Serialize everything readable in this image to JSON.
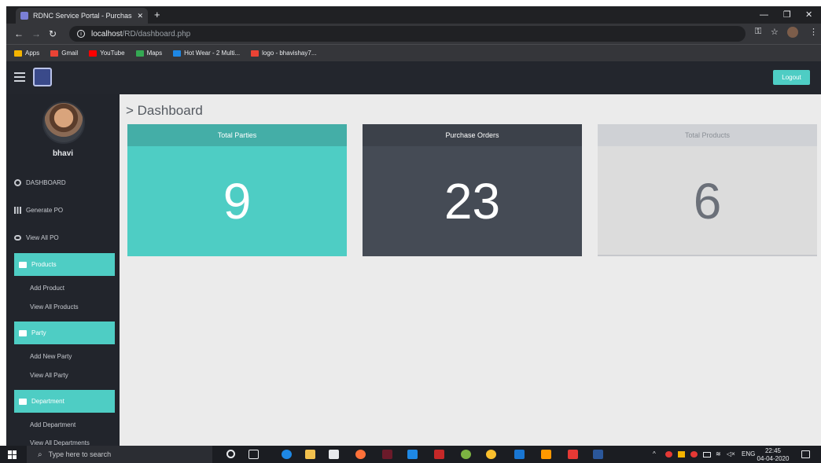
{
  "browser": {
    "tab_title": "RDNC Service Portal - Purchase",
    "tab_close": "✕",
    "new_tab": "+",
    "url_host": "localhost",
    "url_path": "/RD/dashboard.php",
    "bookmarks": [
      {
        "label": "Apps",
        "color": "#f4b400"
      },
      {
        "label": "Gmail",
        "color": "#ea4335"
      },
      {
        "label": "YouTube",
        "color": "#ff0000"
      },
      {
        "label": "Maps",
        "color": "#34a853"
      },
      {
        "label": "Hot Wear - 2 Multi...",
        "color": "#1e88e5"
      },
      {
        "label": "logo - bhavishay7...",
        "color": "#ea4335"
      }
    ]
  },
  "header": {
    "logout_label": "Logout"
  },
  "sidebar": {
    "username": "bhavi",
    "items": [
      {
        "label": "DASHBOARD"
      },
      {
        "label": "Generate PO"
      },
      {
        "label": "View All PO"
      }
    ],
    "sections": [
      {
        "label": "Products",
        "children": [
          "Add Product",
          "View All Products"
        ]
      },
      {
        "label": "Party",
        "children": [
          "Add New Party",
          "View All Party"
        ]
      },
      {
        "label": "Department",
        "children": [
          "Add Department",
          "View All Departments"
        ]
      }
    ]
  },
  "main": {
    "title": "> Dashboard",
    "cards": [
      {
        "label": "Total Parties",
        "value": "9"
      },
      {
        "label": "Purchase Orders",
        "value": "23"
      },
      {
        "label": "Total Products",
        "value": "6"
      }
    ]
  },
  "taskbar": {
    "search_placeholder": "Type here to search",
    "language": "ENG",
    "time": "22:45",
    "date": "04-04-2020"
  },
  "colors": {
    "accent": "#4ecdc4",
    "header_bg": "#23262d",
    "sidebar_bg": "#22252c",
    "main_bg": "#ebebeb"
  }
}
